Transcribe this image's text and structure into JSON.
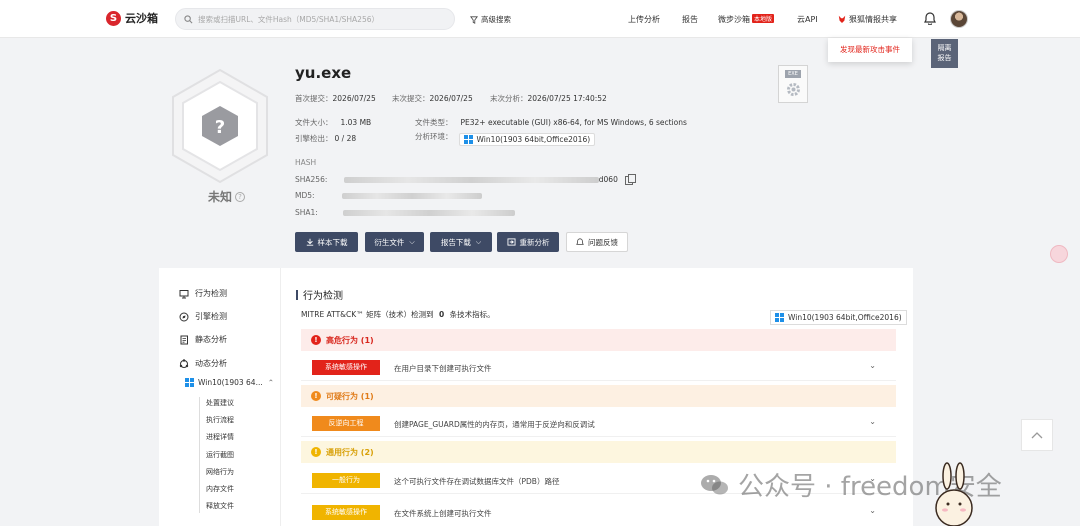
{
  "header": {
    "logo_text": "云沙箱",
    "logo_mark": "S",
    "search_placeholder": "搜索或扫描URL、文件Hash（MD5/SHA1/SHA256）",
    "advanced_search": "高级搜索",
    "nav": [
      "上传分析",
      "报告",
      "微步沙箱",
      "云API",
      "狠狐情报共享"
    ],
    "local_tag": "本地版",
    "popup": "发现最新攻击事件",
    "isolate": [
      "隔离",
      "报告"
    ]
  },
  "summary": {
    "verdict": "未知",
    "hex_symbol": "?",
    "file_name": "yu.exe",
    "first_submit_label": "首次提交：",
    "first_submit": "2026/07/25",
    "last_submit_label": "末次提交：",
    "last_submit": "2026/07/25",
    "last_analysis_label": "末次分析：",
    "last_analysis": "2026/07/25 17:40:52",
    "size_label": "文件大小：",
    "size": "1.03 MB",
    "type_label": "文件类型：",
    "type": "PE32+ executable (GUI) x86-64, for MS Windows, 6 sections",
    "engine_label": "引擎检出：",
    "engine": "0 / 28",
    "env_label": "分析环境：",
    "env": "Win10(1903 64bit,Office2016)",
    "hash_title": "HASH",
    "sha256_label": "SHA256:",
    "sha256_tail": "d060",
    "md5_label": "MD5:",
    "sha1_label": "SHA1:",
    "exe_icon_label": "EXE"
  },
  "actions": {
    "download": "样本下载",
    "derived": "衍生文件",
    "report": "报告下载",
    "reanalyze": "重新分析",
    "feedback": "问题反馈"
  },
  "sidebar": {
    "items": [
      "行为检测",
      "引擎检测",
      "静态分析",
      "动态分析"
    ],
    "env": "Win10(1903 64...",
    "tree": [
      "处置建议",
      "执行流程",
      "进程详情",
      "运行截图",
      "网络行为",
      "内存文件",
      "释放文件"
    ]
  },
  "main": {
    "title": "行为检测",
    "mitre_prefix": "MITRE ATT&CK™ 矩阵（技术）检测到",
    "mitre_count": "0",
    "mitre_suffix": "条技术指标。",
    "env": "Win10(1903 64bit,Office2016)",
    "sections": [
      {
        "title": "高危行为 (1)",
        "rows": [
          {
            "tag": "系统敏感操作",
            "desc": "在用户目录下创建可执行文件"
          }
        ]
      },
      {
        "title": "可疑行为 (1)",
        "rows": [
          {
            "tag": "反逆向工程",
            "desc": "创建PAGE_GUARD属性的内存页，通常用于反逆向和反调试"
          }
        ]
      },
      {
        "title": "通用行为 (2)",
        "rows": [
          {
            "tag": "一般行为",
            "desc": "这个可执行文件存在调试数据库文件（PDB）路径"
          },
          {
            "tag": "系统敏感操作",
            "desc": "在文件系统上创建可执行文件"
          }
        ]
      }
    ]
  },
  "watermark": "公众号 · freedom安全",
  "colors": {
    "brand": "#d9262c",
    "button": "#3e4a65",
    "high": "#e2231a",
    "suspicious": "#f08a1c",
    "general": "#f0b400"
  }
}
